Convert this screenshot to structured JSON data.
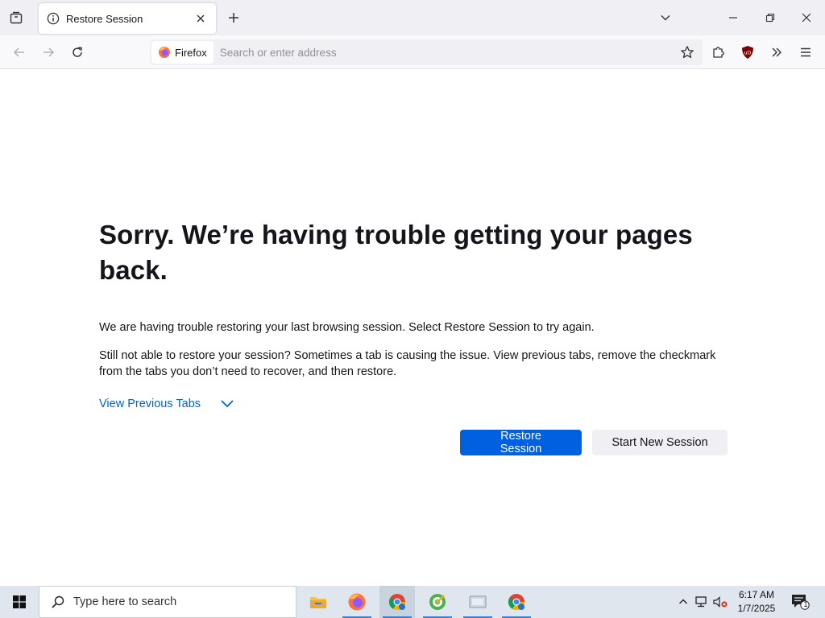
{
  "browser": {
    "tab_title": "Restore Session",
    "identity_label": "Firefox",
    "url_placeholder": "Search or enter address"
  },
  "page": {
    "heading": "Sorry. We’re having trouble getting your pages back.",
    "message1": "We are having trouble restoring your last browsing session. Select Restore Session to try again.",
    "message2": "Still not able to restore your session? Sometimes a tab is causing the issue. View previous tabs, remove the checkmark from the tabs you don’t need to recover, and then restore.",
    "view_tabs_label": "View Previous Tabs",
    "restore_button": "Restore Session",
    "new_session_button": "Start New Session"
  },
  "taskbar": {
    "search_placeholder": "Type here to search",
    "time": "6:17 AM",
    "date": "1/7/2025",
    "notification_count": "1"
  },
  "colors": {
    "accent": "#0061e0",
    "tabbar": "#f0f0f4",
    "taskbar": "#dfe6ee"
  },
  "icons": {
    "tab_list": "tab-list-icon",
    "tab_info": "info-icon",
    "tab_close": "close-icon",
    "new_tab": "plus-icon",
    "back": "back-arrow-icon",
    "forward": "forward-arrow-icon",
    "reload": "reload-icon",
    "bookmark": "star-icon",
    "extensions": "puzzle-icon",
    "ublock": "shield-icon",
    "overflow": "chevrons-right-icon",
    "menu": "hamburger-icon"
  }
}
